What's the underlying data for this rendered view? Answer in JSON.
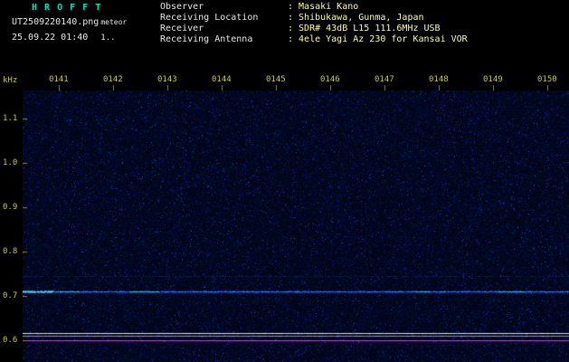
{
  "header": {
    "app_title": "H R O F F T",
    "filename": "UT2509220140.png",
    "mode": "meteor",
    "timestamp": "25.09.22 01:40",
    "counter": "1..",
    "info": [
      {
        "label": "Observer",
        "value": ": Masaki Kano"
      },
      {
        "label": "Receiving Location",
        "value": ": Shibukawa, Gunma, Japan"
      },
      {
        "label": "Receiver",
        "value": ": SDR# 43dB L15 111.6MHz USB"
      },
      {
        "label": "Receiving Antenna",
        "value": ": 4ele Yagi Az 230 for Kansai VOR"
      }
    ]
  },
  "colors": {
    "background": "#000000",
    "title_text": "#00e0c0",
    "header_text": "#e8e8e8",
    "info_label": "#e8e8e8",
    "info_value": "#ffff8c",
    "axis_text": "#c8c84a",
    "tick_mark": "#8a8a2a",
    "trace_white": "#d2d2dc",
    "trace_gray": "#9090b4",
    "trace_magenta": "#b450c8",
    "carrier_blue": "#3c6cff"
  },
  "chart_data": {
    "type": "heatmap",
    "title": "HROFFT 10-minute radio meteor spectrogram",
    "x": {
      "tick_labels": [
        "0141",
        "0142",
        "0143",
        "0144",
        "0145",
        "0146",
        "0147",
        "0148",
        "0149",
        "0150"
      ],
      "start_label": "01:40",
      "unit": "UT hhmm"
    },
    "y": {
      "label": "kHz",
      "tick_labels": [
        "1.1",
        "1.0",
        "0.9",
        "0.8",
        "0.7",
        "0.6"
      ],
      "tick_values": [
        1.1,
        1.0,
        0.9,
        0.8,
        0.7,
        0.6
      ],
      "range": [
        0.55,
        1.16
      ],
      "direction": "down"
    },
    "features": [
      {
        "name": "carrier-signal-line",
        "freq_khz": 0.71,
        "span": "full-width",
        "description": "continuous blue carrier trace, brighter cyan burst at left edge"
      },
      {
        "name": "faint-ridge",
        "freq_khz": 0.745,
        "span": "full-width",
        "description": "faint speckled blue ridge"
      },
      {
        "name": "level-trace-white",
        "freq_khz": 0.616,
        "span": "full-width",
        "description": "flat white signal-level trace"
      },
      {
        "name": "level-trace-gray",
        "freq_khz": 0.61,
        "span": "full-width",
        "description": "flat dim gray trace"
      },
      {
        "name": "level-trace-magenta",
        "freq_khz": 0.6,
        "span": "full-width",
        "description": "flat magenta noise-level trace"
      }
    ],
    "background_description": "dark navy random noise field"
  }
}
